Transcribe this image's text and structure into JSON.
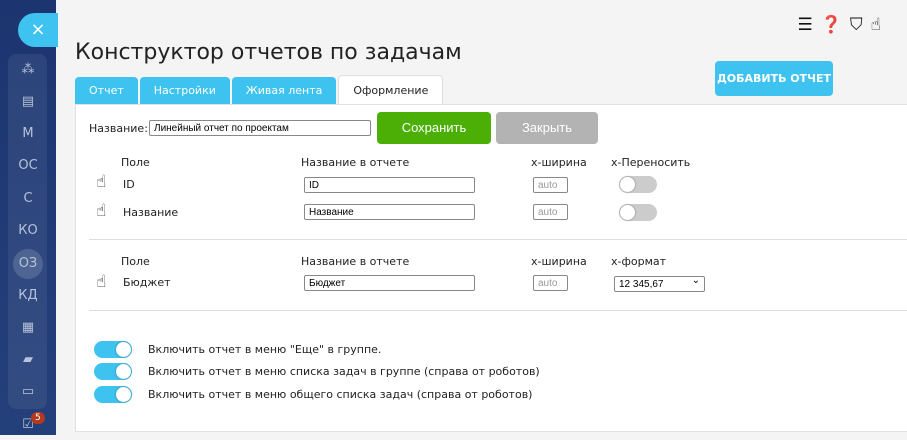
{
  "sidebar": {
    "items": [
      "M",
      "ОС",
      "С",
      "КО",
      "ОЗ",
      "КД"
    ],
    "badge": "5",
    "close": "×"
  },
  "header": {
    "title": "Конструктор отчетов по задачам",
    "add_button": "ДОБАВИТЬ ОТЧЕТ"
  },
  "tabs": [
    "Отчет",
    "Настройки",
    "Живая лента",
    "Оформление"
  ],
  "form": {
    "name_label": "Название:",
    "name_value": "Линейный отчет по проектам",
    "save": "Сохранить",
    "close": "Закрыть"
  },
  "section1": {
    "headers": [
      "Поле",
      "Название в отчете",
      "x-ширина",
      "x-Переносить"
    ],
    "rows": [
      {
        "field": "ID",
        "name": "ID",
        "width": "auto",
        "wrap": false
      },
      {
        "field": "Название",
        "name": "Название",
        "width": "auto",
        "wrap": false
      }
    ]
  },
  "section2": {
    "headers": [
      "Поле",
      "Название в отчете",
      "x-ширина",
      "x-формат"
    ],
    "rows": [
      {
        "field": "Бюджет",
        "name": "Бюджет",
        "width": "auto",
        "format": "12 345,67"
      }
    ]
  },
  "options": [
    {
      "label": "Включить отчет в меню \"Еще\" в группе.",
      "on": true
    },
    {
      "label": "Включить отчет в меню списка задач в группе (справа от роботов)",
      "on": true
    },
    {
      "label": "Включить отчет в меню общего списка задач (справа от роботов)",
      "on": true
    }
  ]
}
